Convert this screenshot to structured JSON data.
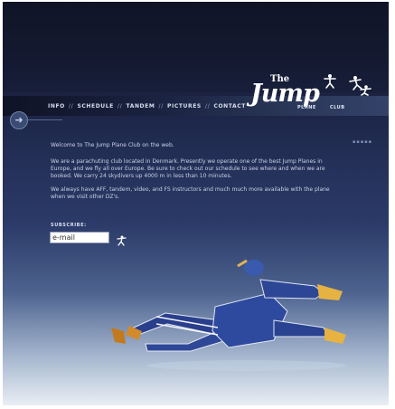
{
  "nav": {
    "items": [
      {
        "label": "INFO"
      },
      {
        "label": "SCHEDULE"
      },
      {
        "label": "TANDEM"
      },
      {
        "label": "PICTURES"
      },
      {
        "label": "CONTACT"
      }
    ],
    "separator": "//"
  },
  "logo": {
    "the": "The",
    "jump": "Jump",
    "plane": "PLANE",
    "club": "CLUB"
  },
  "content": {
    "welcome": "Welcome to The Jump Plane Club on the web.",
    "paragraph1": "We are a parachuting club located in Denmark. Presently we operate one of the best Jump Planes in Europe, and we fly all over Europe. Be sure to check out our schedule to see where and when we are booked. We carry 24 skydivers up 4000 m in less than 10 minutes.",
    "paragraph2": "We always have AFF, tandem, video, and FS instructors and much much more available with the plane when we visit other DZ's."
  },
  "subscribe": {
    "label": "SUBSCRIBE:",
    "email_value": "e-mail"
  },
  "colors": {
    "background_top": "#12162a",
    "background_mid": "#2b3a68",
    "background_bottom": "#e9eef4",
    "nav_text": "#d7def0",
    "body_text": "#c9d2e6"
  }
}
